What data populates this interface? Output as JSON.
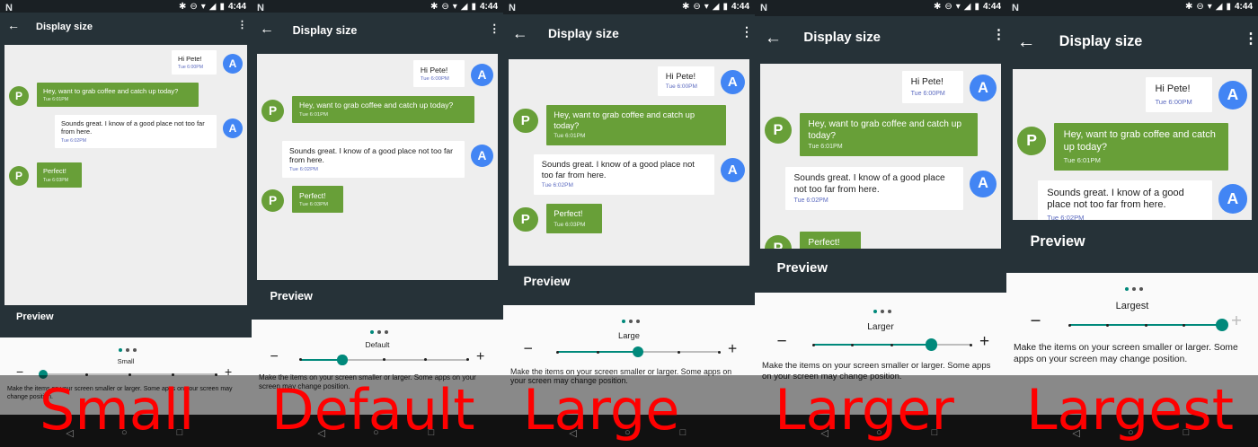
{
  "status": {
    "carrier_glyph": "N",
    "time": "4:44"
  },
  "app": {
    "title": "Display size",
    "back_icon": "arrow-back-icon",
    "more_icon": "more-vert-icon"
  },
  "preview_label": "Preview",
  "description": "Make the items on your screen smaller or larger. Some apps on your screen may change position.",
  "messages": [
    {
      "side": "right",
      "avatar": "A",
      "text": "Hi Pete!",
      "time": "Tue 6:00PM"
    },
    {
      "side": "left",
      "avatar": "P",
      "text": "Hey, want to grab coffee and catch up today?",
      "time": "Tue 6:01PM"
    },
    {
      "side": "right",
      "avatar": "A",
      "text": "Sounds great. I know of a good place not too far from here.",
      "time": "Tue 6:02PM"
    },
    {
      "side": "left",
      "avatar": "P",
      "text": "Perfect!",
      "time": "Tue 6:03PM"
    }
  ],
  "panels": [
    {
      "level": "Small",
      "step": 1,
      "steps": 5,
      "caption": "Small"
    },
    {
      "level": "Default",
      "step": 2,
      "steps": 5,
      "caption": "Default"
    },
    {
      "level": "Large",
      "step": 3,
      "steps": 5,
      "caption": "Large"
    },
    {
      "level": "Larger",
      "step": 4,
      "steps": 5,
      "caption": "Larger"
    },
    {
      "level": "Largest",
      "step": 5,
      "steps": 5,
      "caption": "Largest"
    }
  ],
  "colors": {
    "app_bar": "#263238",
    "accent": "#00897b",
    "bubble_green": "#689f38",
    "avatar_blue": "#4285f4",
    "caption": "#ff0000"
  }
}
